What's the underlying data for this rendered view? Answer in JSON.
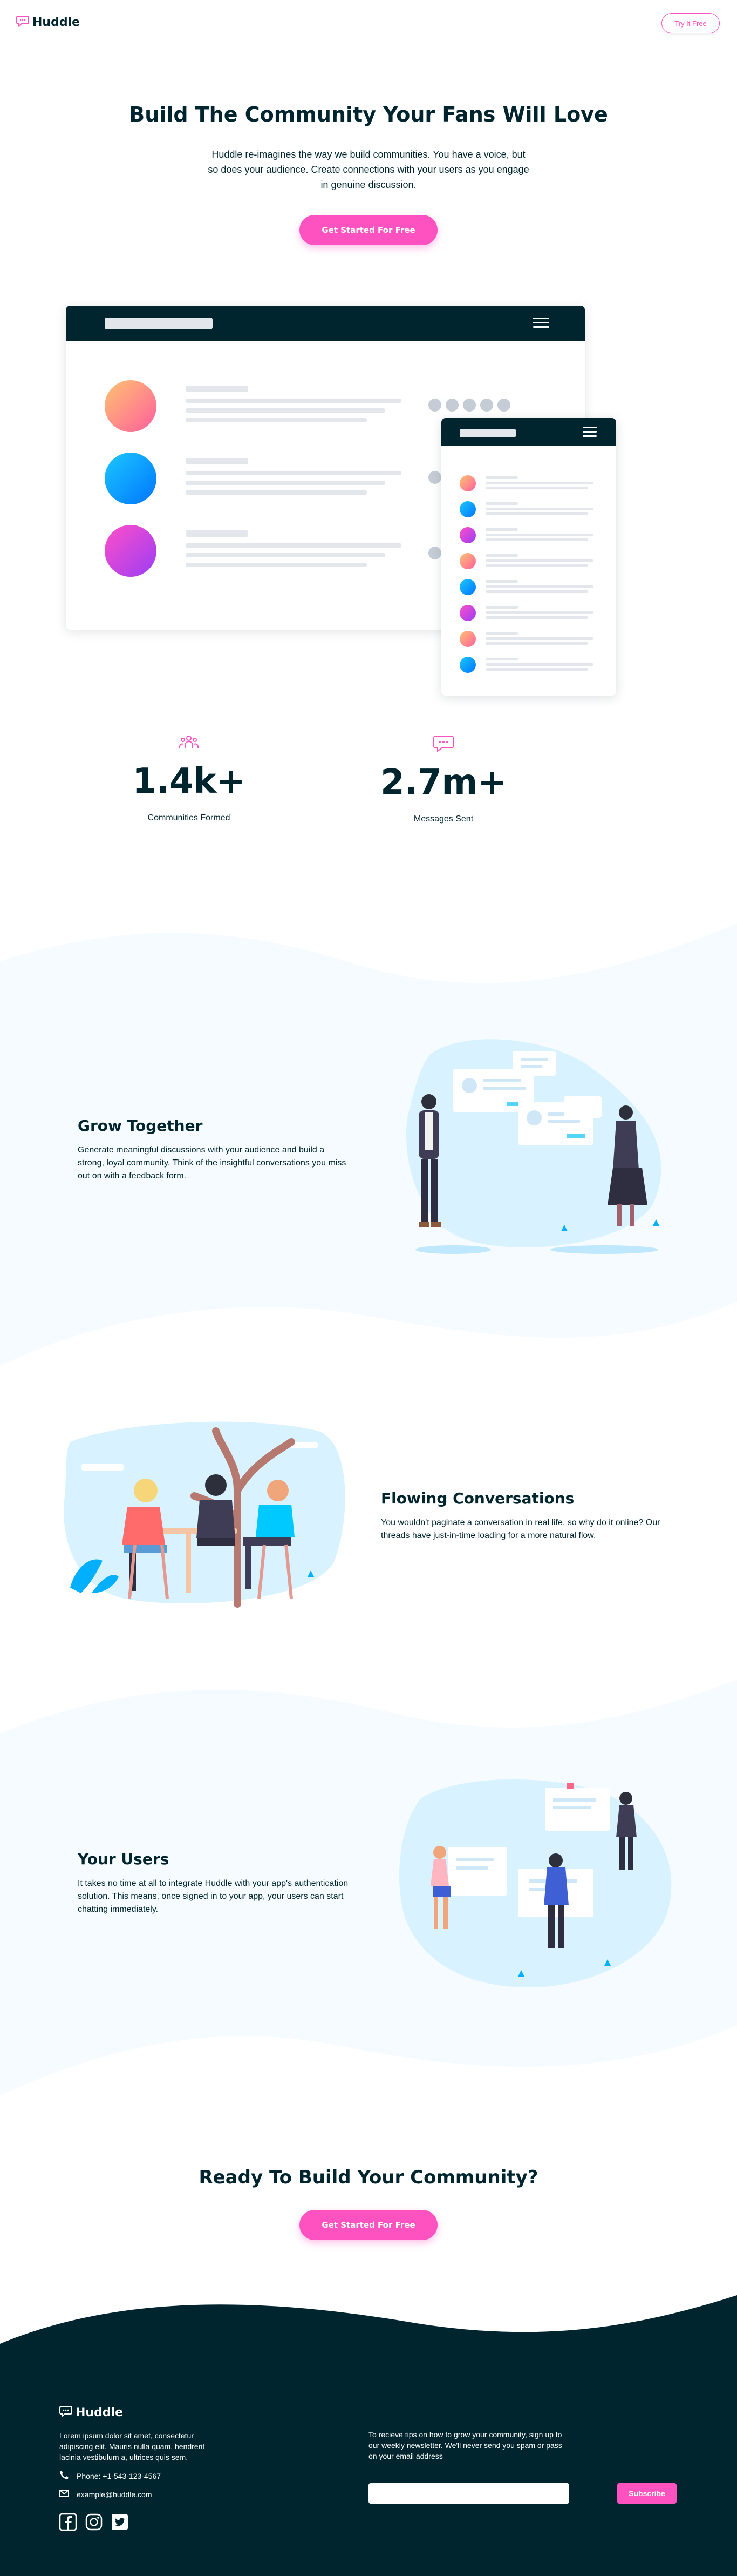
{
  "colors": {
    "brand_dark": "#00252e",
    "accent_pink": "#ff52c1",
    "light_blue_band": "#f5fbff",
    "text": "#00252e"
  },
  "header": {
    "logo_text": "Huddle",
    "logo_icon": "chat-bubble-icon",
    "try_button": "Try It Free"
  },
  "hero": {
    "title": "Build The Community Your Fans Will Love",
    "description": "Huddle re-imagines the way we build communities. You have a voice, but so does your audience. Create connections with your users as you engage in genuine discussion.",
    "cta": "Get Started For Free"
  },
  "stats": [
    {
      "icon": "communities-icon",
      "value": "1.4k+",
      "label": "Communities Formed"
    },
    {
      "icon": "messages-icon",
      "value": "2.7m+",
      "label": "Messages Sent"
    }
  ],
  "features": [
    {
      "title": "Grow Together",
      "description": "Generate meaningful discussions with your audience and build a strong, loyal community. Think of the insightful conversations you miss out on with a feedback form."
    },
    {
      "title": "Flowing Conversations",
      "description": "You wouldn't paginate a conversation in real life, so why do it online? Our threads have just-in-time loading for a more natural flow."
    },
    {
      "title": "Your Users",
      "description": "It takes no time at all to integrate Huddle with your app's authentication solution. This means, once signed in to your app, your users can start chatting immediately."
    }
  ],
  "cta_section": {
    "title": "Ready To Build Your Community?",
    "cta": "Get Started For Free"
  },
  "footer": {
    "logo_text": "Huddle",
    "about": "Lorem ipsum dolor sit amet, consectetur adipiscing elit. Mauris nulla quam, hendrerit lacinia vestibulum a, ultrices quis sem.",
    "phone": "Phone: +1-543-123-4567",
    "email": "example@huddle.com",
    "social": [
      "facebook-icon",
      "instagram-icon",
      "twitter-icon"
    ],
    "newsletter_text": "To recieve tips on how to grow your community, sign up to our weekly newsletter. We'll never send you spam or pass on your email address",
    "subscribe": "Subscribe"
  }
}
